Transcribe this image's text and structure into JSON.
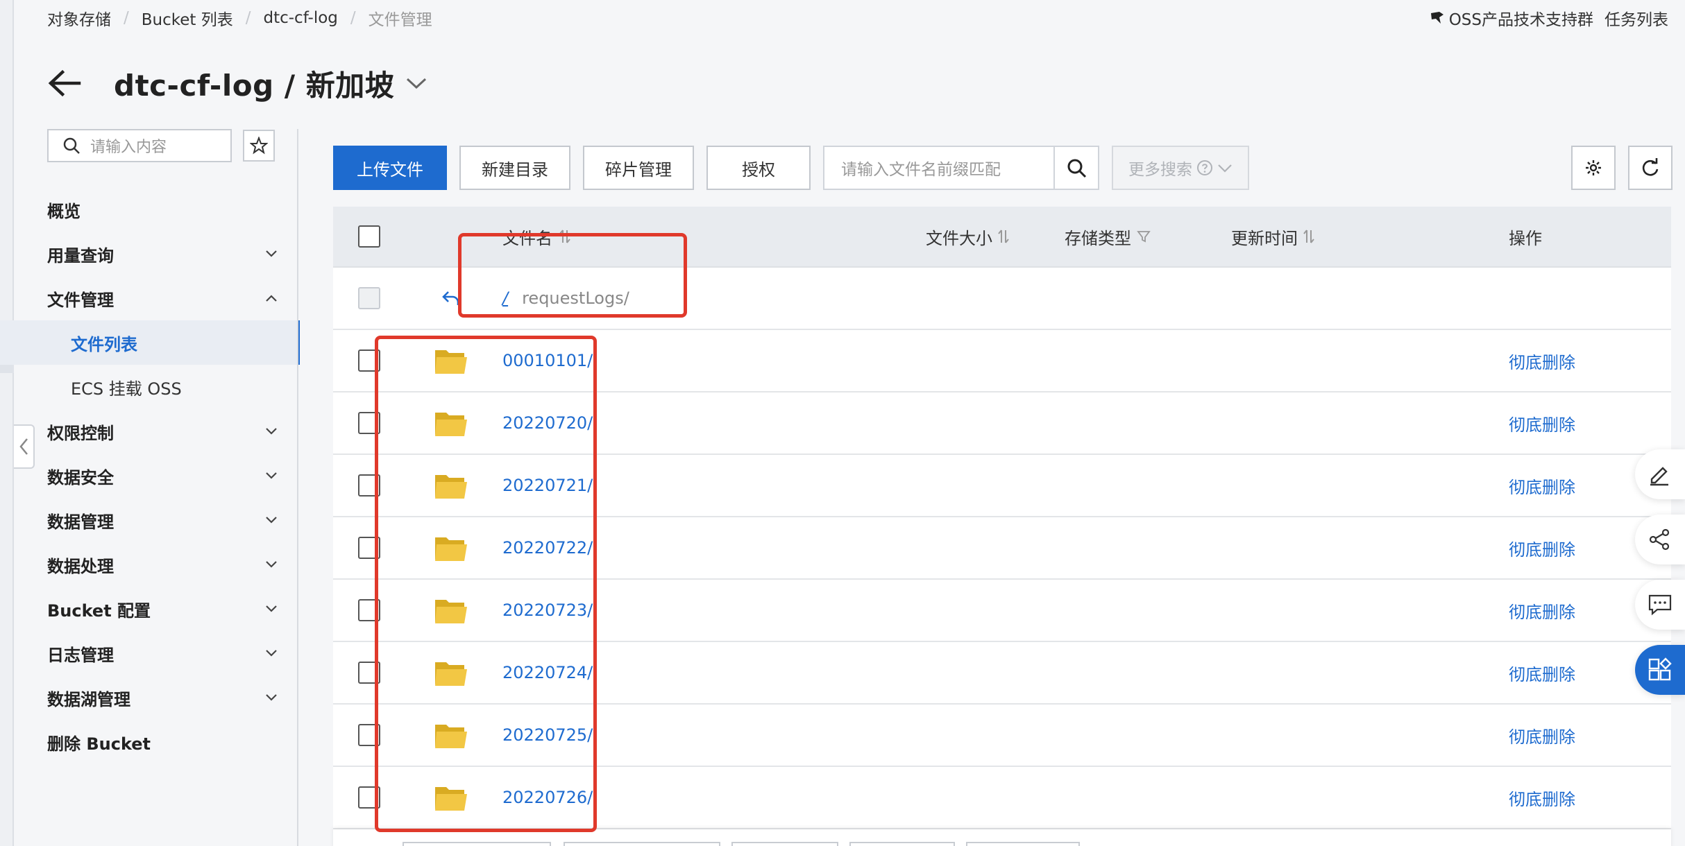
{
  "breadcrumb": {
    "items": [
      "对象存储",
      "Bucket 列表",
      "dtc-cf-log"
    ],
    "current": "文件管理"
  },
  "top_links": {
    "oss_group": "OSS产品技术支持群",
    "tasks": "任务列表"
  },
  "header": {
    "title": "dtc-cf-log / 新加坡"
  },
  "sidebar": {
    "search_placeholder": "请输入内容",
    "items": [
      {
        "label": "概览",
        "chevron": "none"
      },
      {
        "label": "用量查询",
        "chevron": "down"
      },
      {
        "label": "文件管理",
        "chevron": "up"
      },
      {
        "label": "文件列表",
        "sub": true,
        "active": true
      },
      {
        "label": "ECS 挂载 OSS",
        "sub": true
      },
      {
        "label": "权限控制",
        "chevron": "down"
      },
      {
        "label": "数据安全",
        "chevron": "down"
      },
      {
        "label": "数据管理",
        "chevron": "down"
      },
      {
        "label": "数据处理",
        "chevron": "down"
      },
      {
        "label": "Bucket 配置",
        "chevron": "down"
      },
      {
        "label": "日志管理",
        "chevron": "down"
      },
      {
        "label": "数据湖管理",
        "chevron": "down"
      },
      {
        "label": "删除 Bucket",
        "chevron": "none"
      }
    ]
  },
  "toolbar": {
    "upload": "上传文件",
    "new_dir": "新建目录",
    "fragments": "碎片管理",
    "authorize": "授权",
    "search_placeholder": "请输入文件名前缀匹配",
    "more_search": "更多搜索"
  },
  "table": {
    "columns": {
      "name": "文件名",
      "size": "文件大小",
      "type": "存储类型",
      "time": "更新时间",
      "op": "操作"
    },
    "path": {
      "root": "/",
      "current": "requestLogs/"
    },
    "rows": [
      {
        "name": "00010101/",
        "action": "彻底删除"
      },
      {
        "name": "20220720/",
        "action": "彻底删除"
      },
      {
        "name": "20220721/",
        "action": "彻底删除"
      },
      {
        "name": "20220722/",
        "action": "彻底删除"
      },
      {
        "name": "20220723/",
        "action": "彻底删除"
      },
      {
        "name": "20220724/",
        "action": "彻底删除"
      },
      {
        "name": "20220725/",
        "action": "彻底删除"
      },
      {
        "name": "20220726/",
        "action": "彻底删除"
      }
    ]
  },
  "colors": {
    "primary": "#1e6bcf",
    "folder": "#f2c744",
    "annotation": "#e0392b"
  },
  "icons": {
    "floating": [
      "edit-icon",
      "share-icon",
      "feedback-icon",
      "apps-icon"
    ]
  }
}
